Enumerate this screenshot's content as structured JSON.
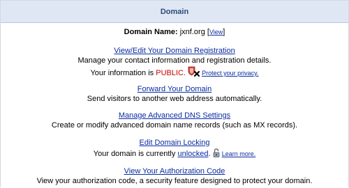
{
  "header": {
    "title": "Domain"
  },
  "domain_name": {
    "label": "Domain Name:",
    "value": "jxnf.org",
    "view_link": "View"
  },
  "sections": {
    "registration": {
      "link": "View/Edit Your Domain Registration",
      "description": "Manage your contact information and registration details.",
      "privacy_prefix": "Your information is",
      "privacy_status": "PUBLIC.",
      "privacy_link": "Protect your privacy."
    },
    "forward": {
      "link": "Forward Your Domain",
      "description": "Send visitors to another web address automatically."
    },
    "dns": {
      "link": "Manage Advanced DNS Settings",
      "description": "Create or modify advanced domain name records (such as MX records)."
    },
    "locking": {
      "link": "Edit Domain Locking",
      "status_prefix": "Your domain is currently",
      "status_value": "unlocked",
      "status_suffix": ".",
      "learn_more": "Learn more."
    },
    "auth_code": {
      "link": "View Your Authorization Code",
      "description": "View your authorization code, a security feature designed to protect your domain."
    }
  },
  "colors": {
    "header_bg": "#dee7f3",
    "header_text": "#2c4a78",
    "link": "#0a2ca0",
    "public_status": "#cc0000"
  },
  "icons": {
    "privacy": "shield-x-icon",
    "lock": "padlock-icon"
  }
}
